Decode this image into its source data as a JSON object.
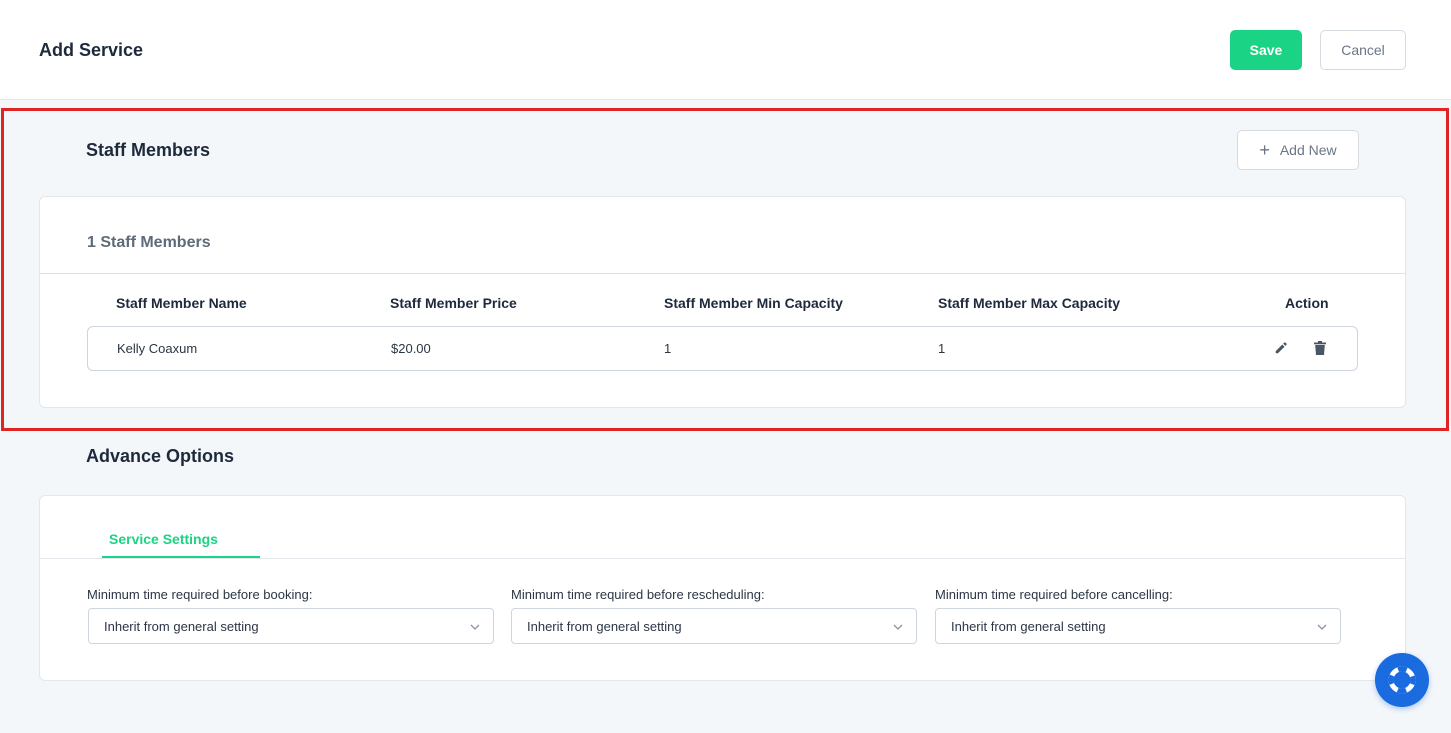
{
  "header": {
    "title": "Add Service",
    "save_label": "Save",
    "cancel_label": "Cancel"
  },
  "staff_section": {
    "title": "Staff Members",
    "add_new_label": "Add New",
    "count_label": "1 Staff Members",
    "columns": [
      "Staff Member Name",
      "Staff Member Price",
      "Staff Member Min Capacity",
      "Staff Member Max Capacity",
      "Action"
    ],
    "rows": [
      {
        "name": "Kelly Coaxum",
        "price": "$20.00",
        "min_capacity": "1",
        "max_capacity": "1"
      }
    ]
  },
  "advance_section": {
    "title": "Advance Options",
    "tab_label": "Service Settings",
    "fields": [
      {
        "label": "Minimum time required before booking:",
        "value": "Inherit from general setting"
      },
      {
        "label": "Minimum time required before rescheduling:",
        "value": "Inherit from general setting"
      },
      {
        "label": "Minimum time required before cancelling:",
        "value": "Inherit from general setting"
      }
    ]
  },
  "icons": {
    "add": "plus-icon",
    "edit": "pencil-icon",
    "delete": "trash-icon",
    "dropdown": "chevron-down-icon",
    "help": "lifebuoy-icon"
  },
  "colors": {
    "accent": "#1bd384",
    "highlight": "#e02424",
    "help_button": "#1a6be0"
  }
}
